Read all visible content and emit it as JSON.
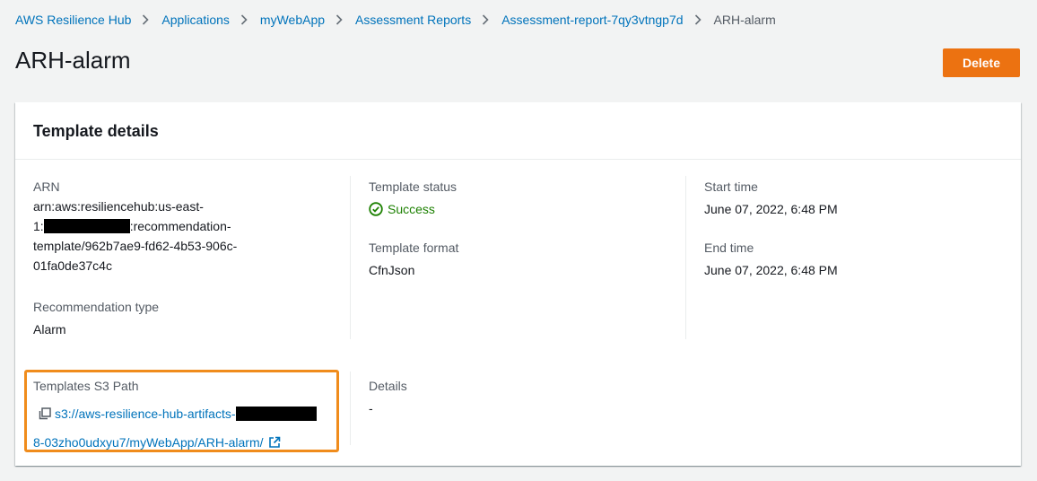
{
  "breadcrumb": {
    "items": [
      "AWS Resilience Hub",
      "Applications",
      "myWebApp",
      "Assessment Reports",
      "Assessment-report-7qy3vtngp7d"
    ],
    "current": "ARH-alarm"
  },
  "page": {
    "title": "ARH-alarm",
    "delete_label": "Delete"
  },
  "panel": {
    "title": "Template details",
    "arn": {
      "label": "ARN",
      "line1": "arn:aws:resiliencehub:us-east-",
      "line2_prefix": "1:",
      "line2_suffix": ":recommendation-",
      "line3": "template/962b7ae9-fd62-4b53-906c-",
      "line4": "01fa0de37c4c"
    },
    "recommendation_type": {
      "label": "Recommendation type",
      "value": "Alarm"
    },
    "template_status": {
      "label": "Template status",
      "value": "Success"
    },
    "template_format": {
      "label": "Template format",
      "value": "CfnJson"
    },
    "start_time": {
      "label": "Start time",
      "value": "June 07, 2022, 6:48 PM"
    },
    "end_time": {
      "label": "End time",
      "value": "June 07, 2022, 6:48 PM"
    },
    "s3_path": {
      "label": "Templates S3 Path",
      "line1": "s3://aws-resilience-hub-artifacts-",
      "line2": "8-03zho0udxyu7/myWebApp/ARH-alarm/"
    },
    "details": {
      "label": "Details",
      "value": "-"
    }
  },
  "colors": {
    "link": "#0073bb",
    "primary_button": "#ec7211",
    "success": "#1d8102",
    "highlight": "#f08c1c",
    "background": "#f2f3f3"
  },
  "icons": [
    "chevron-right-icon",
    "check-circle-icon",
    "copy-icon",
    "external-link-icon"
  ]
}
